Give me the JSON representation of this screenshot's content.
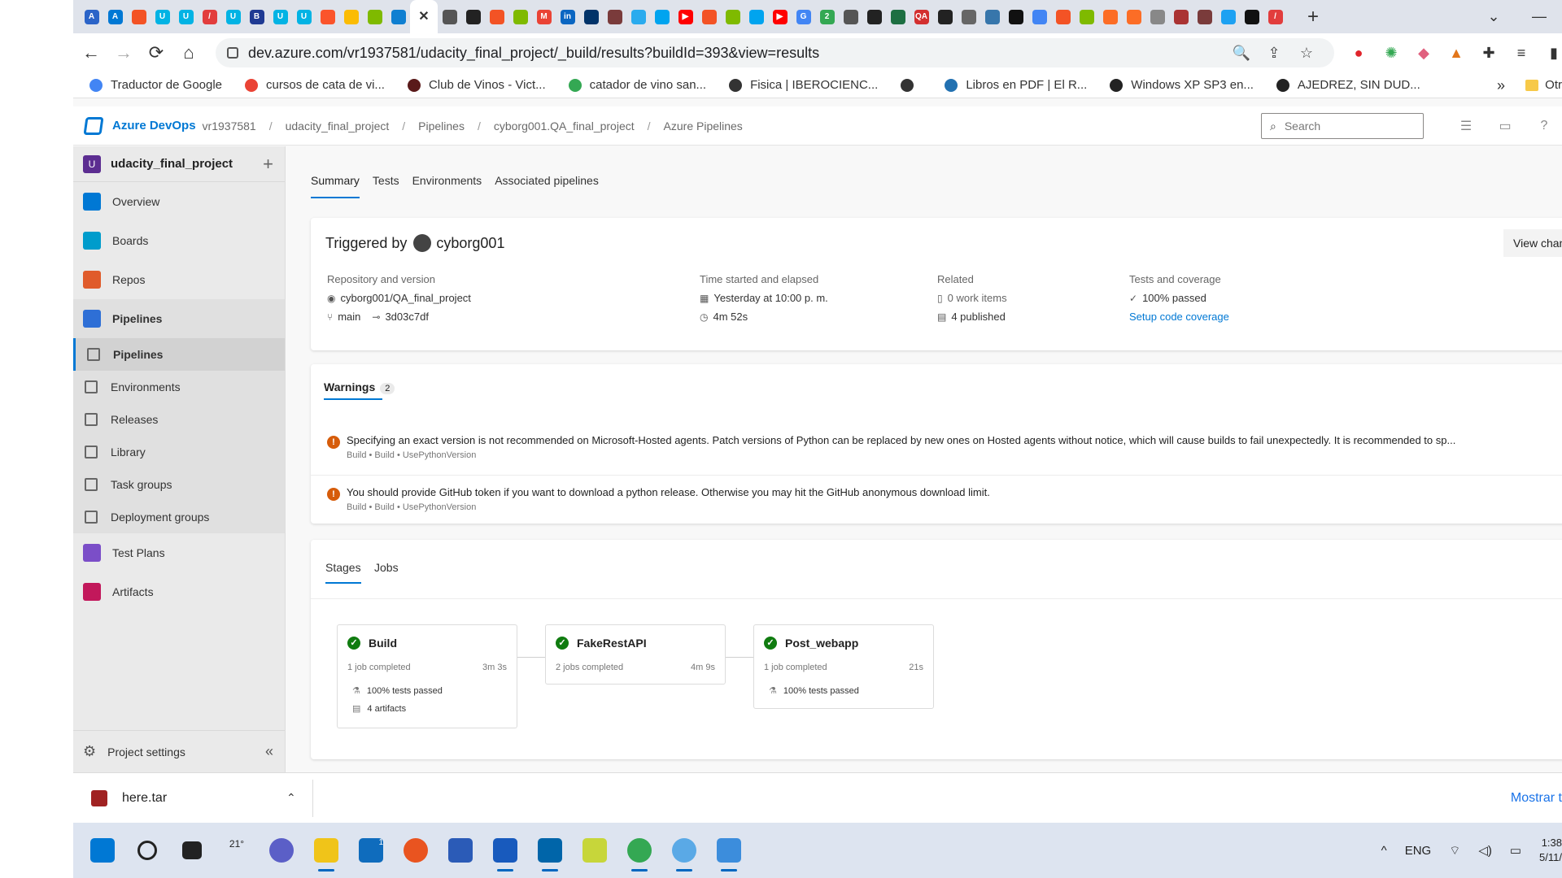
{
  "browser": {
    "tabs": [
      "Azure Boards",
      "Azure",
      "Microsoft",
      "Udacity",
      "Udacity",
      "Slash",
      "Udacity",
      "Board",
      "Udacity",
      "Udacity",
      "Brave",
      "Idea",
      "Microsoft",
      "Edge",
      "Close",
      "Globe",
      "GitHub",
      "Microsoft",
      "Microsoft",
      "Gmail",
      "LinkedIn",
      "NFL",
      "Seal",
      "Telegram",
      "Microsoft",
      "YouTube",
      "Microsoft",
      "Microsoft",
      "Microsoft",
      "YouTube",
      "Google",
      "Circle 2",
      "Globe",
      "GitHub",
      "Excel",
      "QA",
      "GitHub",
      "Book",
      "Python",
      "Pen",
      "Docs",
      "Microsoft",
      "Microsoft",
      "GitLab",
      "GitLab",
      "Chrome",
      "Seal",
      "Seal",
      "Bird",
      "Dev",
      "Slash"
    ],
    "new_tab": "+",
    "url": "dev.azure.com/vr1937581/udacity_final_project/_build/results?buildId=393&view=results",
    "colors": {
      "tab_strip": "#dfe3eb",
      "omnibox": "#f1f3f4"
    }
  },
  "bookmarks": [
    {
      "label": "Traductor de Google",
      "color": "#4285f4"
    },
    {
      "label": "cursos de cata de vi...",
      "color": "#ea4335"
    },
    {
      "label": "Club de Vinos - Vict...",
      "color": "#5a1a1a"
    },
    {
      "label": "catador de vino san...",
      "color": "#34a853"
    },
    {
      "label": "Fisica | IBEROCIENC...",
      "color": "#333333"
    },
    {
      "label": "",
      "color": "#333333"
    },
    {
      "label": "Libros en PDF | El R...",
      "color": "#2271b1"
    },
    {
      "label": "Windows XP SP3 en...",
      "color": "#222222"
    },
    {
      "label": "AJEDREZ, SIN DUD...",
      "color": "#222222"
    }
  ],
  "bookmarks_more": "»",
  "bookmarks_other": "Otr",
  "header": {
    "brand": "Azure DevOps",
    "org": "vr1937581",
    "crumbs": [
      "udacity_final_project",
      "Pipelines",
      "cyborg001.QA_final_project",
      "Azure Pipelines"
    ],
    "search_placeholder": "Search"
  },
  "sidebar": {
    "project_initial": "U",
    "project": "udacity_final_project",
    "items": [
      {
        "label": "Overview",
        "color": "#0078d4"
      },
      {
        "label": "Boards",
        "color": "#009ccc"
      },
      {
        "label": "Repos",
        "color": "#e05b2b"
      },
      {
        "label": "Pipelines",
        "color": "#2e6fd6"
      }
    ],
    "subitems": [
      "Pipelines",
      "Environments",
      "Releases",
      "Library",
      "Task groups",
      "Deployment groups"
    ],
    "items2": [
      {
        "label": "Test Plans",
        "color": "#7b4ec8"
      },
      {
        "label": "Artifacts",
        "color": "#c2185b"
      }
    ],
    "footer": "Project settings"
  },
  "main": {
    "tabs": [
      "Summary",
      "Tests",
      "Environments",
      "Associated pipelines"
    ],
    "triggered_label": "Triggered by",
    "triggered_user": "cyborg001",
    "view_changes": "View change",
    "repo": {
      "label": "Repository and version",
      "name": "cyborg001/QA_final_project",
      "branch": "main",
      "commit": "3d03c7df"
    },
    "time": {
      "label": "Time started and elapsed",
      "started": "Yesterday at 10:00 p. m.",
      "elapsed": "4m 52s"
    },
    "related": {
      "label": "Related",
      "work_items": "0 work items",
      "published": "4 published"
    },
    "tests": {
      "label": "Tests and coverage",
      "passed": "100% passed",
      "coverage_link": "Setup code coverage"
    },
    "warnings": {
      "title": "Warnings",
      "count": "2",
      "items": [
        {
          "text": "Specifying an exact version is not recommended on Microsoft-Hosted agents. Patch versions of Python can be replaced by new ones on Hosted agents without notice, which will cause builds to fail unexpectedly. It is recommended to sp...",
          "source": "Build • Build • UsePythonVersion"
        },
        {
          "text": "You should provide GitHub token if you want to download a python release. Otherwise you may hit the GitHub anonymous download limit.",
          "source": "Build • Build • UsePythonVersion"
        }
      ]
    },
    "stage_tabs": [
      "Stages",
      "Jobs"
    ],
    "stages": [
      {
        "name": "Build",
        "jobs": "1 job completed",
        "duration": "3m 3s",
        "tests": "100% tests passed",
        "artifacts": "4 artifacts"
      },
      {
        "name": "FakeRestAPI",
        "jobs": "2 jobs completed",
        "duration": "4m 9s"
      },
      {
        "name": "Post_webapp",
        "jobs": "1 job completed",
        "duration": "21s",
        "tests": "100% tests passed"
      }
    ]
  },
  "download": {
    "file": "here.tar",
    "show_all": "Mostrar t"
  },
  "taskbar": {
    "weather": "21°",
    "mail_badge": "1",
    "lang": "ENG",
    "time": "1:38",
    "date": "5/11/"
  }
}
